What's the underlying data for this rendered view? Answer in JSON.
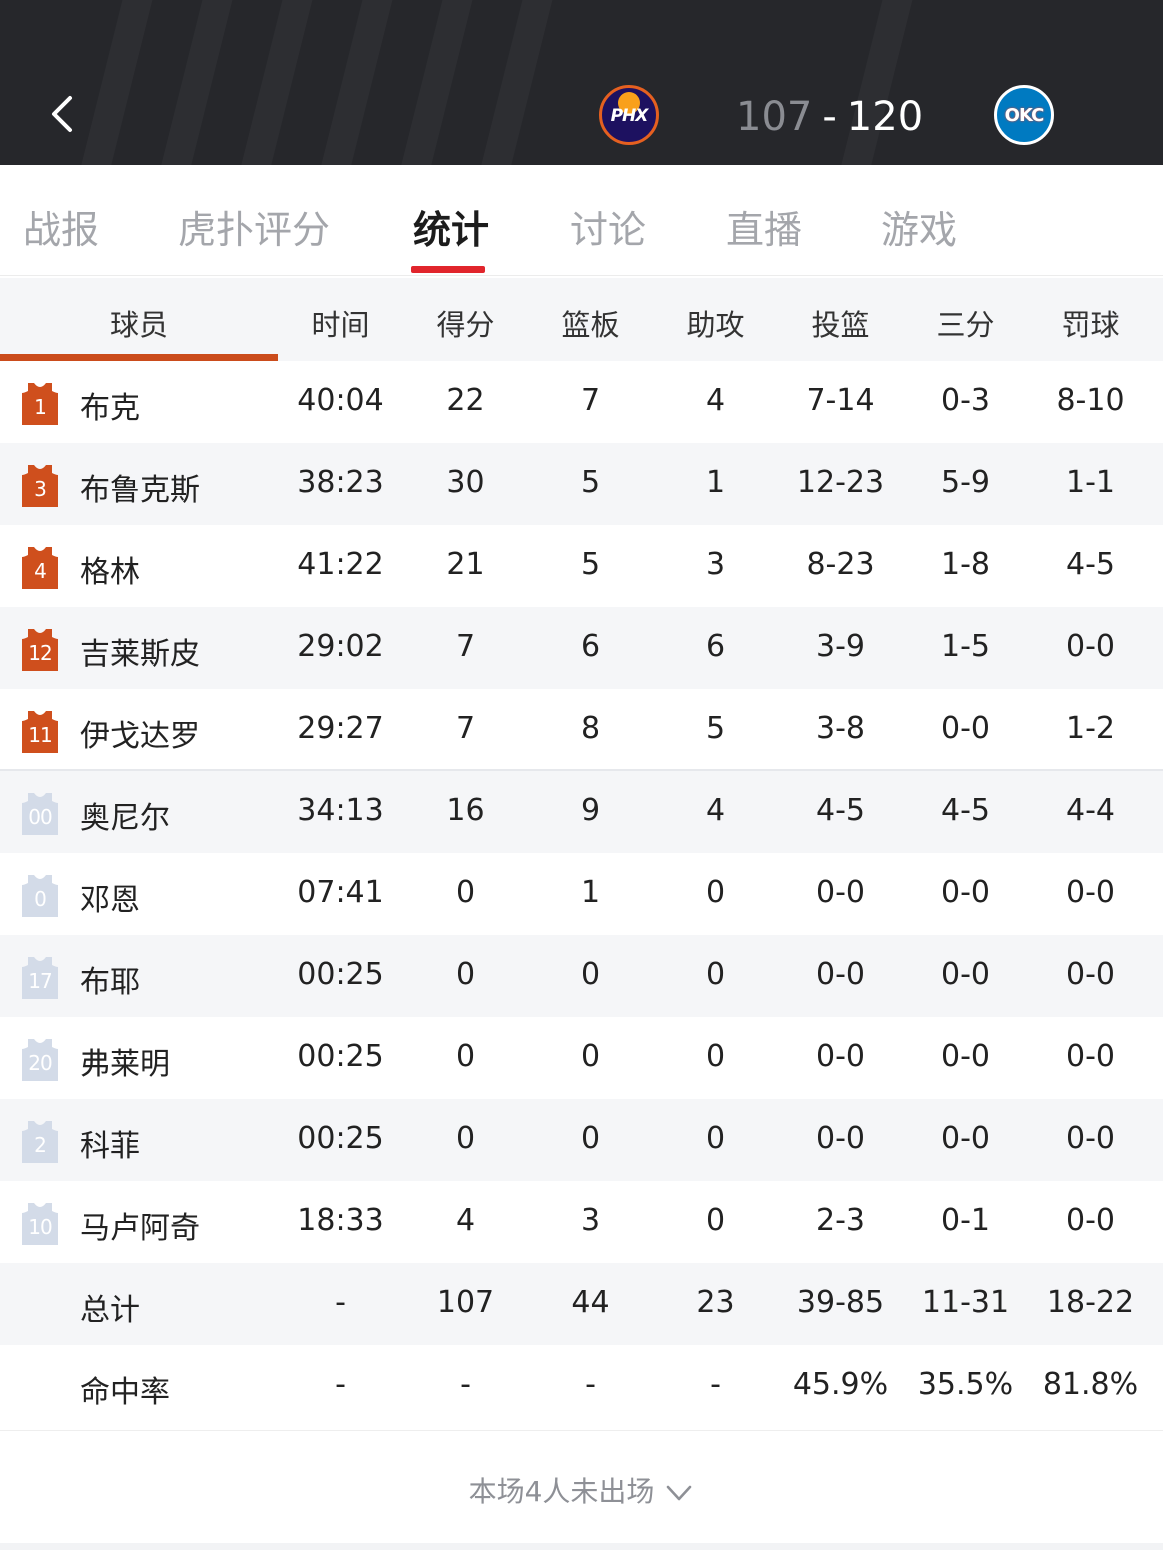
{
  "header": {
    "home_team": "PHX",
    "away_team": "OKC",
    "home_score": "107",
    "separator": "-",
    "away_score": "120"
  },
  "tabs": [
    {
      "label": "战报",
      "active": false
    },
    {
      "label": "虎扑评分",
      "active": false
    },
    {
      "label": "统计",
      "active": true
    },
    {
      "label": "讨论",
      "active": false
    },
    {
      "label": "直播",
      "active": false
    },
    {
      "label": "游戏",
      "active": false
    }
  ],
  "table": {
    "columns": [
      "球员",
      "时间",
      "得分",
      "篮板",
      "助攻",
      "投篮",
      "三分",
      "罚球"
    ],
    "players": [
      {
        "number": "1",
        "name": "布克",
        "starter": true,
        "time": "40:04",
        "pts": "22",
        "reb": "7",
        "ast": "4",
        "fg": "7-14",
        "tp": "0-3",
        "ft": "8-10"
      },
      {
        "number": "3",
        "name": "布鲁克斯",
        "starter": true,
        "time": "38:23",
        "pts": "30",
        "reb": "5",
        "ast": "1",
        "fg": "12-23",
        "tp": "5-9",
        "ft": "1-1"
      },
      {
        "number": "4",
        "name": "格林",
        "starter": true,
        "time": "41:22",
        "pts": "21",
        "reb": "5",
        "ast": "3",
        "fg": "8-23",
        "tp": "1-8",
        "ft": "4-5"
      },
      {
        "number": "12",
        "name": "吉莱斯皮",
        "starter": true,
        "time": "29:02",
        "pts": "7",
        "reb": "6",
        "ast": "6",
        "fg": "3-9",
        "tp": "1-5",
        "ft": "0-0"
      },
      {
        "number": "11",
        "name": "伊戈达罗",
        "starter": true,
        "time": "29:27",
        "pts": "7",
        "reb": "8",
        "ast": "5",
        "fg": "3-8",
        "tp": "0-0",
        "ft": "1-2"
      },
      {
        "number": "00",
        "name": "奥尼尔",
        "starter": false,
        "time": "34:13",
        "pts": "16",
        "reb": "9",
        "ast": "4",
        "fg": "4-5",
        "tp": "4-5",
        "ft": "4-4"
      },
      {
        "number": "0",
        "name": "邓恩",
        "starter": false,
        "time": "07:41",
        "pts": "0",
        "reb": "1",
        "ast": "0",
        "fg": "0-0",
        "tp": "0-0",
        "ft": "0-0"
      },
      {
        "number": "17",
        "name": "布耶",
        "starter": false,
        "time": "00:25",
        "pts": "0",
        "reb": "0",
        "ast": "0",
        "fg": "0-0",
        "tp": "0-0",
        "ft": "0-0"
      },
      {
        "number": "20",
        "name": "弗莱明",
        "starter": false,
        "time": "00:25",
        "pts": "0",
        "reb": "0",
        "ast": "0",
        "fg": "0-0",
        "tp": "0-0",
        "ft": "0-0"
      },
      {
        "number": "2",
        "name": "科菲",
        "starter": false,
        "time": "00:25",
        "pts": "0",
        "reb": "0",
        "ast": "0",
        "fg": "0-0",
        "tp": "0-0",
        "ft": "0-0"
      },
      {
        "number": "10",
        "name": "马卢阿奇",
        "starter": false,
        "time": "18:33",
        "pts": "4",
        "reb": "3",
        "ast": "0",
        "fg": "2-3",
        "tp": "0-1",
        "ft": "0-0"
      }
    ],
    "totals": {
      "name": "总计",
      "time": "-",
      "pts": "107",
      "reb": "44",
      "ast": "23",
      "fg": "39-85",
      "tp": "11-31",
      "ft": "18-22"
    },
    "percent": {
      "name": "命中率",
      "time": "-",
      "pts": "-",
      "reb": "-",
      "ast": "-",
      "fg": "45.9%",
      "tp": "35.5%",
      "ft": "81.8%"
    }
  },
  "footer": {
    "dnp_label": "本场4人未出场"
  },
  "colors": {
    "starter_jersey": "#cf4f1d",
    "bench_jersey": "#d3dbe8",
    "accent": "#e1252c",
    "header_bg": "#26272b"
  },
  "icons": {
    "back": "chevron-left-icon",
    "expand": "chevron-down-icon",
    "jersey": "jersey-icon"
  }
}
